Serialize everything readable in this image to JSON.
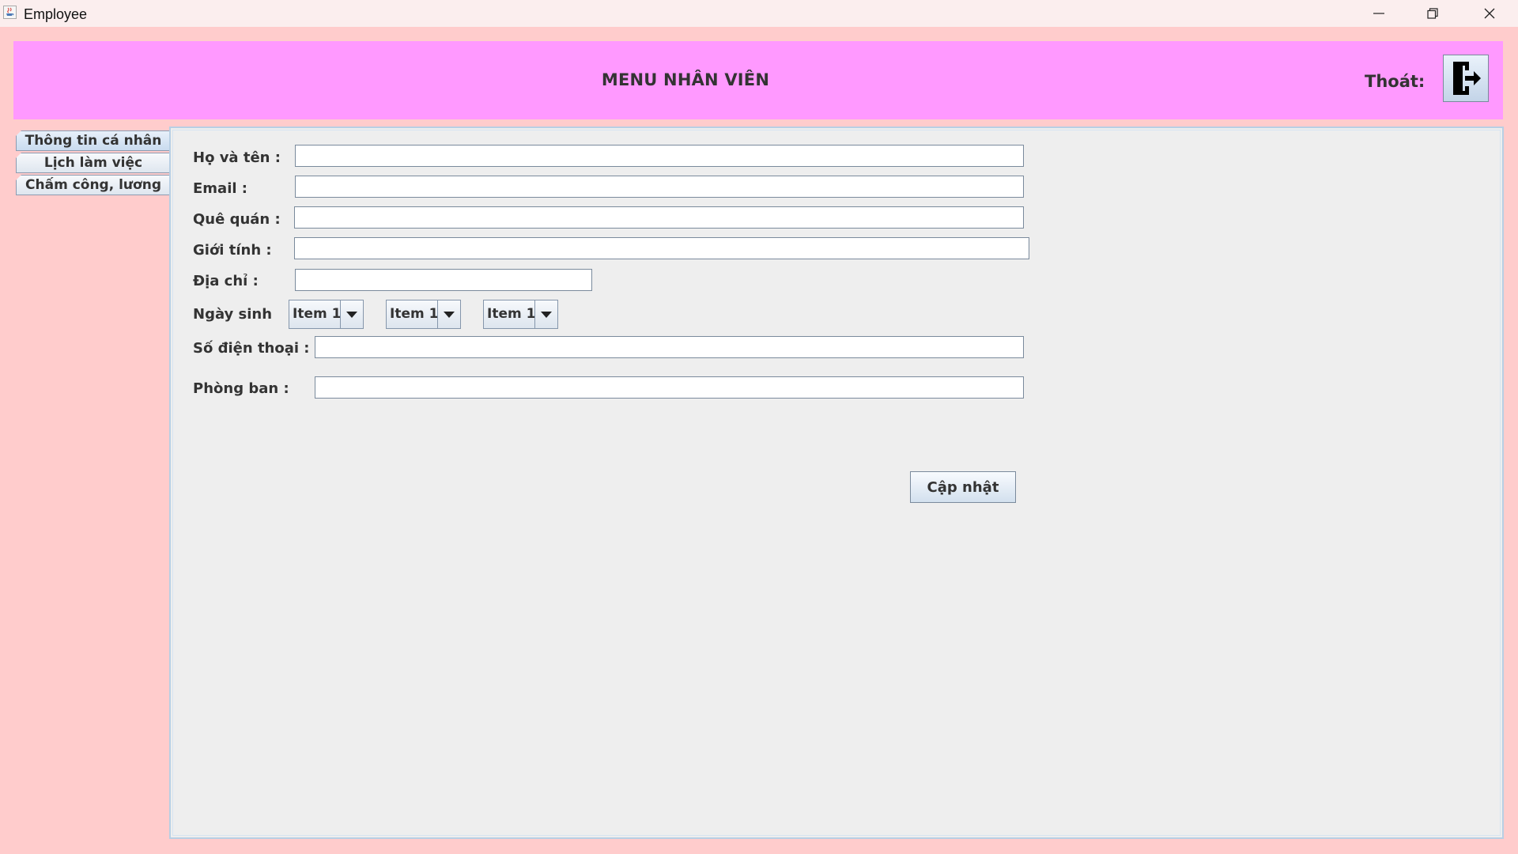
{
  "window": {
    "title": "Employee"
  },
  "header": {
    "title": "MENU NHÂN VIÊN",
    "exit_label": "Thoát:"
  },
  "tabs": [
    {
      "label": "Thông tin cá nhân",
      "active": true
    },
    {
      "label": "Lịch làm việc",
      "active": false
    },
    {
      "label": "Chấm công, lương",
      "active": false
    }
  ],
  "form": {
    "full_name": {
      "label": "Họ và tên :",
      "value": ""
    },
    "email": {
      "label": "Email :",
      "value": ""
    },
    "hometown": {
      "label": "Quê quán :",
      "value": ""
    },
    "gender": {
      "label": "Giới tính :",
      "value": ""
    },
    "address": {
      "label": "Địa chỉ :",
      "value": ""
    },
    "birthdate": {
      "label": "Ngày sinh",
      "day": "Item 1",
      "month": "Item 1",
      "year": "Item 1"
    },
    "phone": {
      "label": "Số điện thoại :",
      "value": ""
    },
    "department": {
      "label": "Phòng ban :",
      "value": ""
    },
    "update_button": "Cập nhật"
  },
  "colors": {
    "window_background": "#ffcccc",
    "header_background": "#ff99ff",
    "panel_background": "#eeeeee"
  }
}
